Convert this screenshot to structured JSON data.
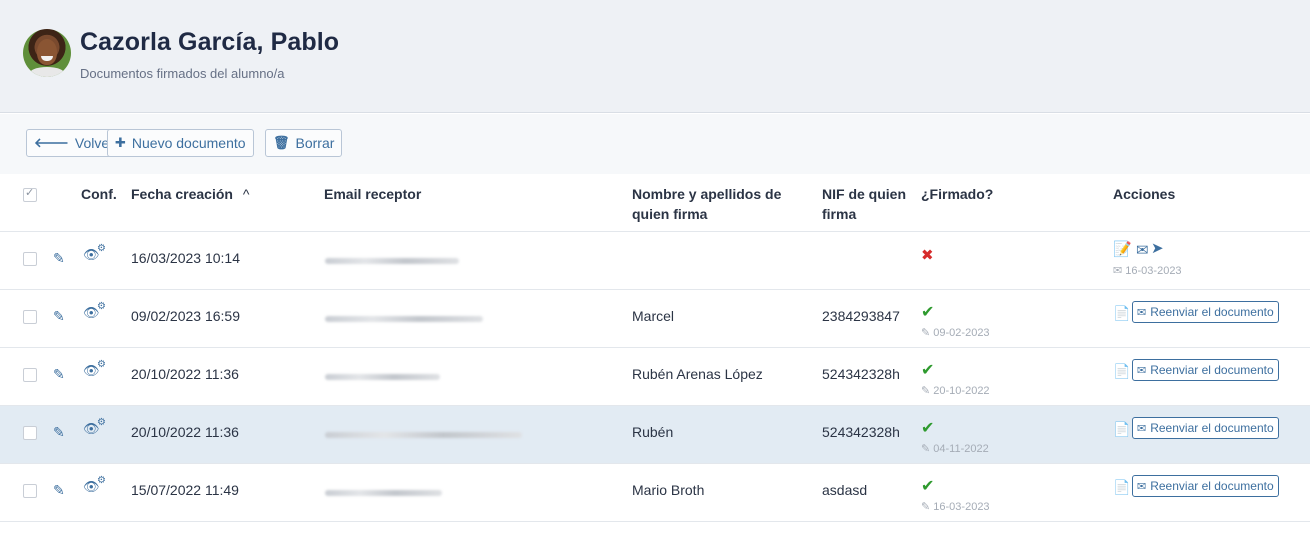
{
  "header": {
    "title": "Cazorla García, Pablo",
    "subtitle": "Documentos firmados del alumno/a"
  },
  "toolbar": {
    "back_label": "Volver",
    "new_label": "Nuevo documento",
    "delete_label": "Borrar"
  },
  "table": {
    "columns": {
      "conf": "Conf.",
      "fecha": "Fecha creación",
      "email": "Email receptor",
      "nombre_line1": "Nombre y apellidos de",
      "nombre_line2": "quien firma",
      "nif_line1": "NIF de quien",
      "nif_line2": "firma",
      "firmado": "¿Firmado?",
      "acciones": "Acciones"
    },
    "resend_label": "Reenviar el documento",
    "rows": [
      {
        "fecha": "16/03/2023 10:14",
        "nombre": "",
        "nif": "",
        "firmado": false,
        "sent_date": "16-03-2023",
        "highlight": false
      },
      {
        "fecha": "09/02/2023 16:59",
        "nombre": "Marcel",
        "nif": "2384293847",
        "firmado": true,
        "signed_date": "09-02-2023",
        "highlight": false
      },
      {
        "fecha": "20/10/2022 11:36",
        "nombre": "Rubén Arenas López",
        "nif": "524342328h",
        "firmado": true,
        "signed_date": "20-10-2022",
        "highlight": false
      },
      {
        "fecha": "20/10/2022 11:36",
        "nombre": "Rubén",
        "nif": "524342328h",
        "firmado": true,
        "signed_date": "04-11-2022",
        "highlight": true
      },
      {
        "fecha": "15/07/2022 11:49",
        "nombre": "Mario Broth",
        "nif": "asdasd",
        "firmado": true,
        "signed_date": "16-03-2023",
        "highlight": false
      }
    ]
  },
  "colors": {
    "accent": "#3d6f9f",
    "ok": "#2e9a2e",
    "error": "#d62b2b",
    "highlight_row": "#e2ebf3"
  }
}
